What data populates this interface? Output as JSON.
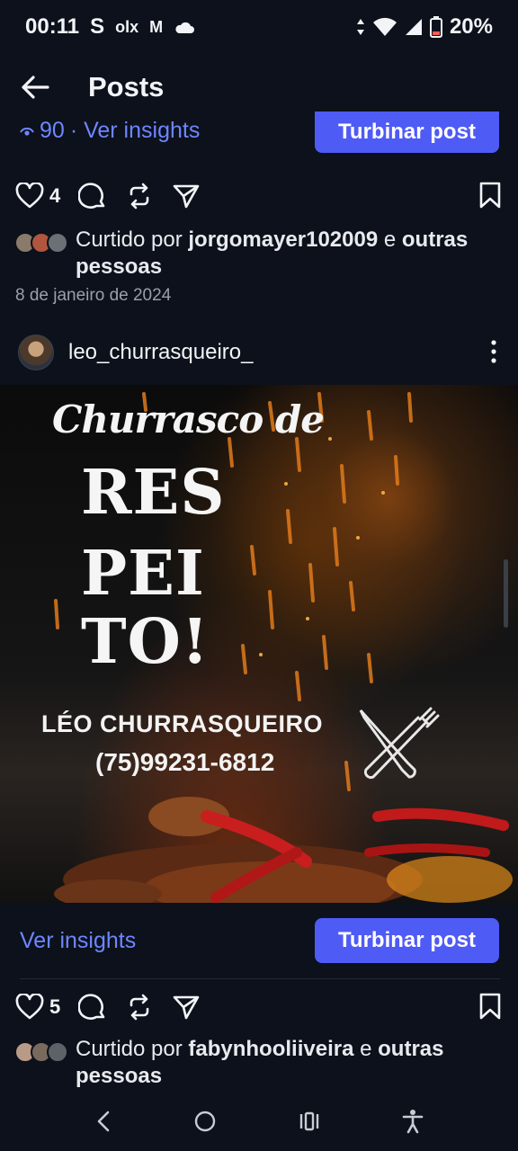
{
  "status_bar": {
    "time": "00:11",
    "notif_s": "S",
    "notif_olx": "olx",
    "notif_gmail": "M",
    "battery": "20%"
  },
  "header": {
    "title": "Posts"
  },
  "previous_post": {
    "views": "90",
    "insights_label": "· Ver insights",
    "boost_label": "Turbinar post",
    "likes_count": "4",
    "liked_prefix": "Curtido por ",
    "liked_user": "jorgomayer102009",
    "liked_mid": " e ",
    "liked_suffix": "outras pessoas",
    "date": "8 de janeiro de 2024"
  },
  "post": {
    "username": "leo_churrasqueiro_",
    "image": {
      "script_text": "Churrasco de",
      "line1": "RES",
      "line2": "PEI",
      "line3": "TO!",
      "brand": "LÉO CHURRASQUEIRO",
      "phone": "(75)99231-6812"
    },
    "insights_label": "Ver insights",
    "boost_label": "Turbinar post",
    "likes_count": "5",
    "liked_prefix": "Curtido por ",
    "liked_user": "fabynhooliiveira",
    "liked_mid": " e ",
    "liked_suffix": "outras pessoas"
  },
  "colors": {
    "background": "#0c111b",
    "accent_link": "#6e86ff",
    "boost_button": "#4f5bf5"
  },
  "icons": {
    "status": [
      "signal-icon",
      "wifi-icon",
      "battery-icon",
      "cloud-icon"
    ],
    "actions": [
      "heart-icon",
      "comment-icon",
      "repost-icon",
      "send-icon",
      "bookmark-icon"
    ],
    "nav": [
      "back-nav-icon",
      "home-nav-icon",
      "recents-nav-icon",
      "accessibility-icon"
    ]
  }
}
